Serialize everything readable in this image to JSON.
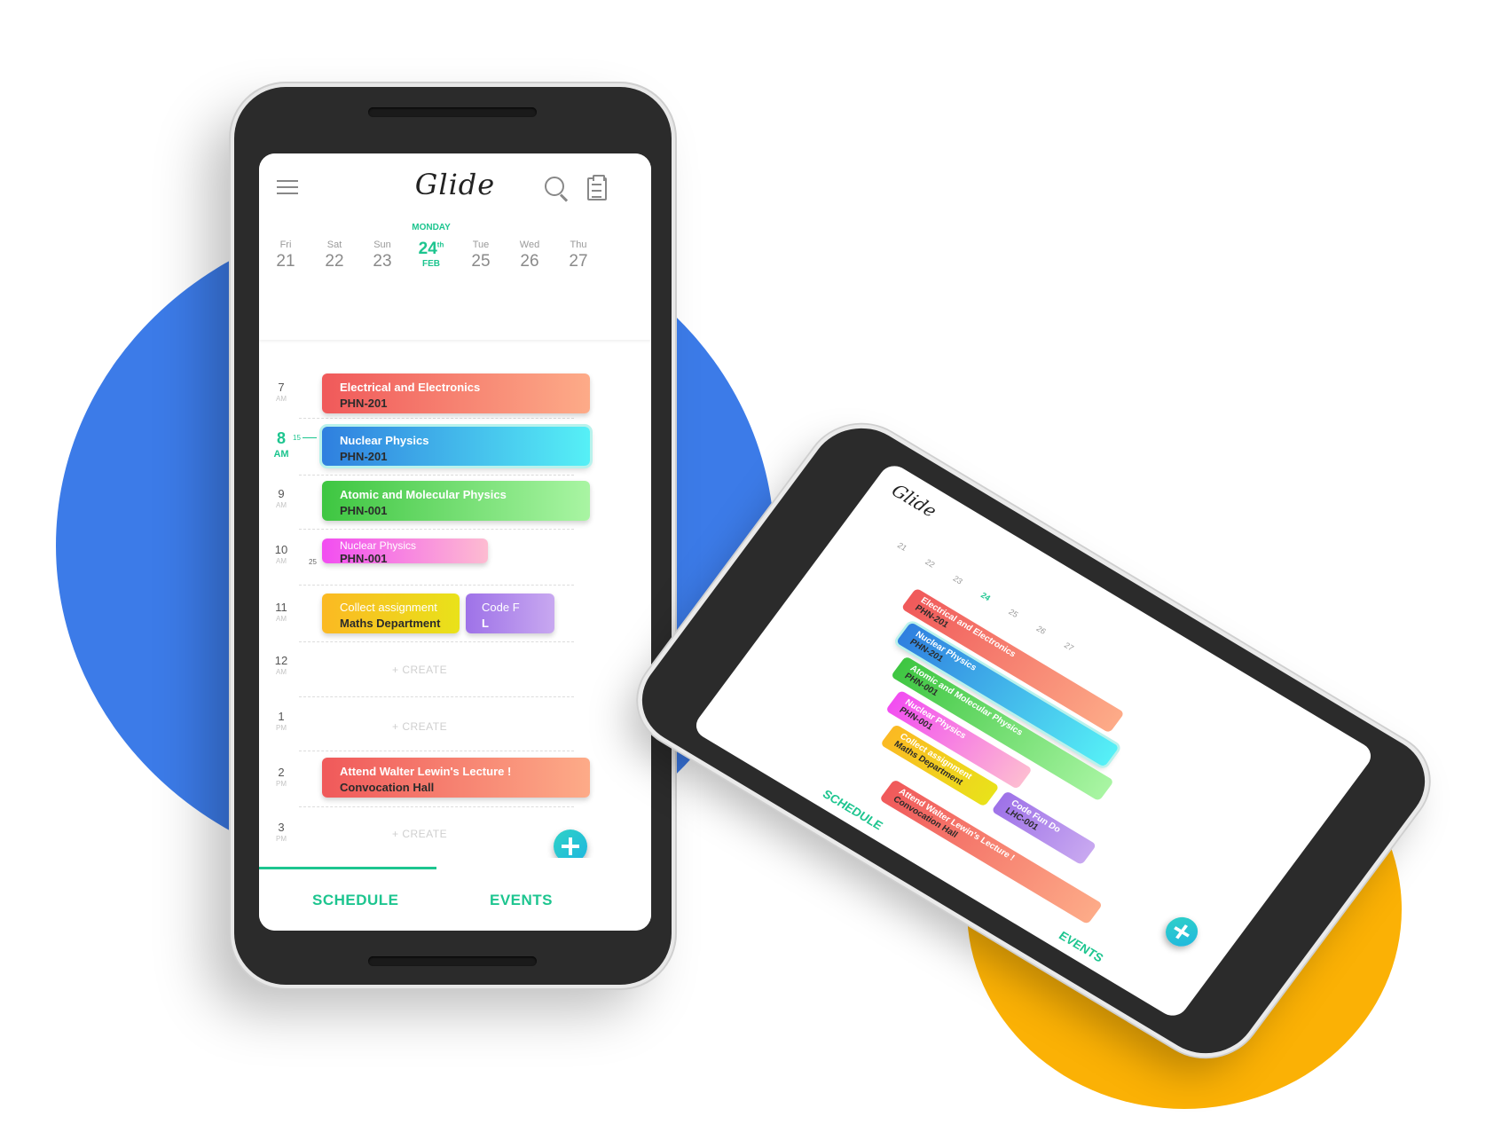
{
  "app": {
    "title": "Glide"
  },
  "week": [
    {
      "name": "Fri",
      "date": "21"
    },
    {
      "name": "Sat",
      "date": "22"
    },
    {
      "name": "Sun",
      "date": "23"
    },
    {
      "name": "MONDAY",
      "date": "24",
      "suffix": "th",
      "month": "FEB",
      "selected": true
    },
    {
      "name": "Tue",
      "date": "25"
    },
    {
      "name": "Wed",
      "date": "26"
    },
    {
      "name": "Thu",
      "date": "27"
    }
  ],
  "hours": [
    {
      "n": "7",
      "ap": "AM"
    },
    {
      "n": "8",
      "ap": "AM",
      "current": true
    },
    {
      "n": "9",
      "ap": "AM"
    },
    {
      "n": "10",
      "ap": "AM"
    },
    {
      "n": "11",
      "ap": "AM"
    },
    {
      "n": "12",
      "ap": "AM"
    },
    {
      "n": "1",
      "ap": "PM"
    },
    {
      "n": "2",
      "ap": "PM"
    },
    {
      "n": "3",
      "ap": "PM"
    }
  ],
  "now_marker": "15",
  "min_marker": "25",
  "events": [
    {
      "title": "Electrical and Electronics",
      "sub": "PHN-201",
      "color": "#f0595a"
    },
    {
      "title": "Nuclear Physics",
      "sub": "PHN-201",
      "color": "#2f7fdf"
    },
    {
      "title": "Atomic and Molecular Physics",
      "sub": "PHN-001",
      "color": "#3ec641"
    },
    {
      "title": "Nuclear Physics",
      "sub": "PHN-001",
      "color": "#f24df1"
    },
    {
      "title": "Collect assignment",
      "sub": "Maths Department",
      "color": "#fbb923"
    },
    {
      "title": "Code Fun Do",
      "sub": "LHC-001",
      "color": "#9e72e8",
      "short_title": "Code F",
      "short_sub": "L"
    },
    {
      "title": "Attend Walter Lewin's Lecture !",
      "sub": "Convocation Hall",
      "color": "#f0595a"
    }
  ],
  "create_label": "+  CREATE",
  "tabs": {
    "schedule": "SCHEDULE",
    "events": "EVENTS"
  },
  "accent": "#1dc58f"
}
